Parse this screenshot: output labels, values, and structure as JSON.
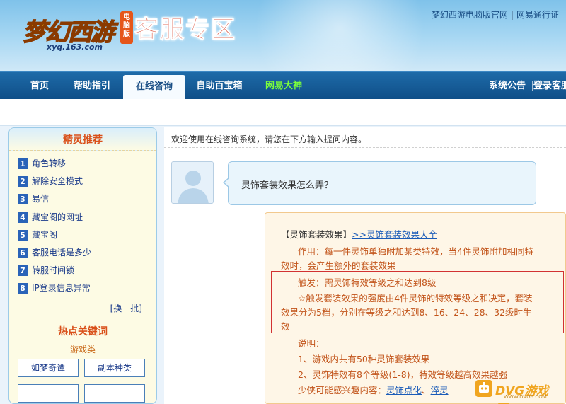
{
  "header": {
    "logo_text": "梦幻西游",
    "logo_badge": "电脑版",
    "logo_url": "xyq.163.com",
    "zone_title": "客服专区",
    "links": [
      "梦幻西游电脑版官网",
      "网易通行证"
    ]
  },
  "nav": {
    "items": [
      "首页",
      "帮助指引",
      "在线咨询",
      "自助百宝箱",
      "网易大神"
    ],
    "right": [
      "系统公告",
      "登录客服"
    ],
    "active": "在线咨询"
  },
  "sidebar": {
    "title": "精灵推荐",
    "items": [
      {
        "num": "1",
        "label": "角色转移"
      },
      {
        "num": "2",
        "label": "解除安全模式"
      },
      {
        "num": "3",
        "label": "易信"
      },
      {
        "num": "4",
        "label": "藏宝阁的网址"
      },
      {
        "num": "5",
        "label": "藏宝阁"
      },
      {
        "num": "6",
        "label": "客服电话是多少"
      },
      {
        "num": "7",
        "label": "转服时间锁"
      },
      {
        "num": "8",
        "label": "IP登录信息异常"
      }
    ],
    "more": "[换一批]",
    "hot_title": "热点关键词",
    "category": "-游戏类-",
    "buttons": [
      "如梦奇谭",
      "副本种类"
    ]
  },
  "chat": {
    "welcome": "欢迎使用在线咨询系统，请您在下方输入提问内容。",
    "question": "灵饰套装效果怎么弄？",
    "answer": {
      "title": "【灵饰套装效果】",
      "title_link": ">>灵饰套装效果大全",
      "effect_1": "作用：每一件灵饰单独附加某类特效，当4件灵饰附加相同特",
      "effect_2": "效时，会产生额外的套装效果",
      "trigger": "触发：需灵饰特效等级之和达到8级",
      "trigger_detail_1": "☆触发套装效果的强度由4件灵饰的特效等级之和决定，套装",
      "trigger_detail_2": "效果分为5档，分别在等级之和达到8、16、24、28、32级时生",
      "trigger_detail_3": "效",
      "note_title": "说明：",
      "note_1": "1、游戏内共有50种灵饰套装效果",
      "note_2": "2、灵饰特效有8个等级(1-8)，特效等级越高效果越强",
      "note_3_prefix": "少侠可能感兴趣内容：",
      "note_3_link1": "灵饰点化",
      "note_3_sep": "、",
      "note_3_link2": "淬灵"
    }
  },
  "watermark": {
    "text": "DVG游戏网",
    "sub": "WWW.DVG6.COM"
  },
  "colors": {
    "nav_bg": "#0f4f88",
    "accent_orange": "#c2541a",
    "highlight_red": "#d23232",
    "link_blue": "#1a5bb8"
  }
}
